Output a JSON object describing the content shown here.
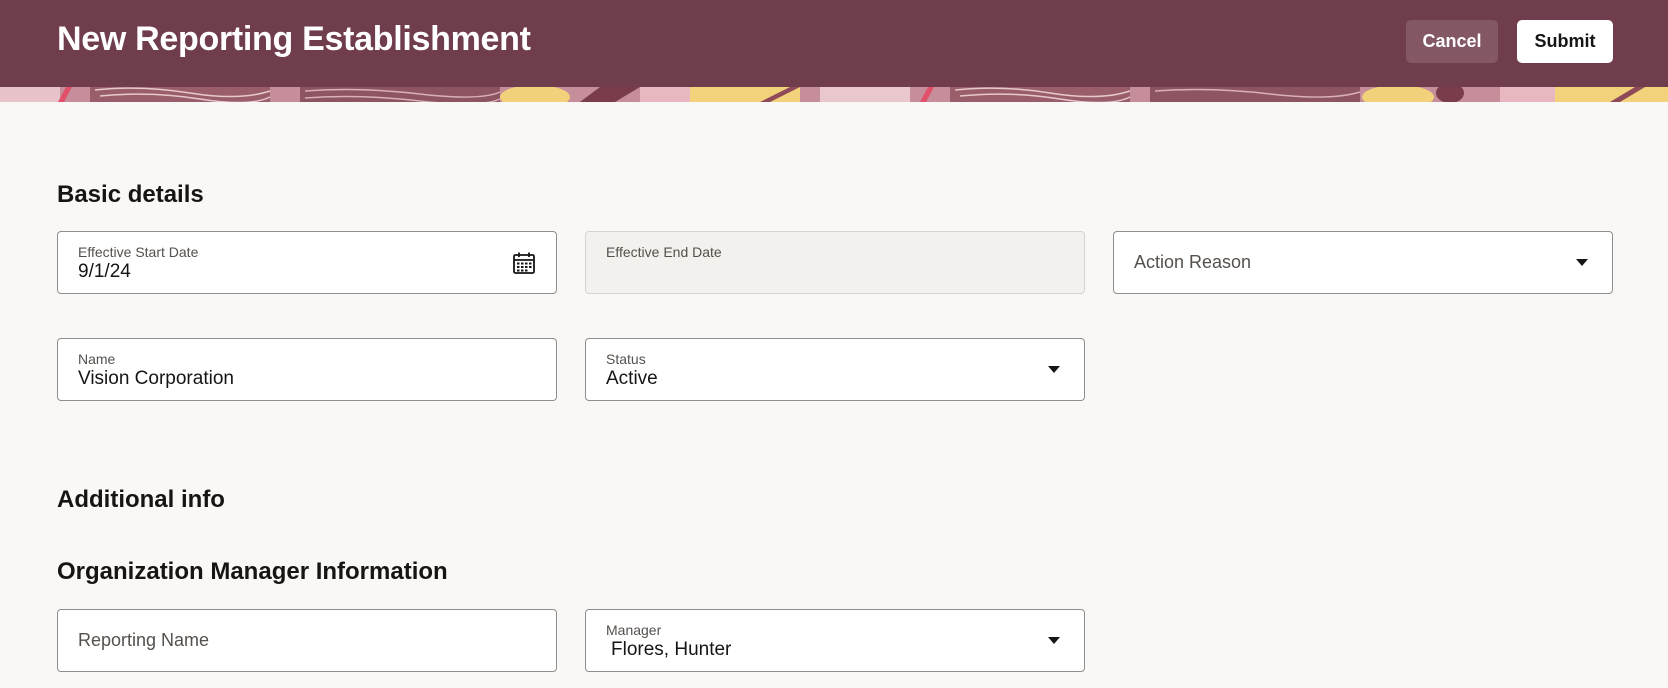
{
  "header": {
    "title": "New Reporting Establishment",
    "cancel_label": "Cancel",
    "submit_label": "Submit",
    "background_color": "#6f3d4b"
  },
  "sections": {
    "basic_details": "Basic details",
    "additional_info": "Additional info",
    "org_manager_info": "Organization Manager Information"
  },
  "fields": {
    "effective_start_date": {
      "label": "Effective Start Date",
      "value": "9/1/24",
      "icon": "calendar-icon"
    },
    "effective_end_date": {
      "label": "Effective End Date",
      "value": ""
    },
    "action_reason": {
      "placeholder": "Action Reason",
      "icon": "chevron-down-icon"
    },
    "name": {
      "label": "Name",
      "value": "Vision Corporation"
    },
    "status": {
      "label": "Status",
      "value": "Active",
      "icon": "chevron-down-icon"
    },
    "reporting_name": {
      "placeholder": "Reporting Name"
    },
    "manager": {
      "label": "Manager",
      "value": "Flores, Hunter",
      "icon": "chevron-down-icon"
    }
  }
}
